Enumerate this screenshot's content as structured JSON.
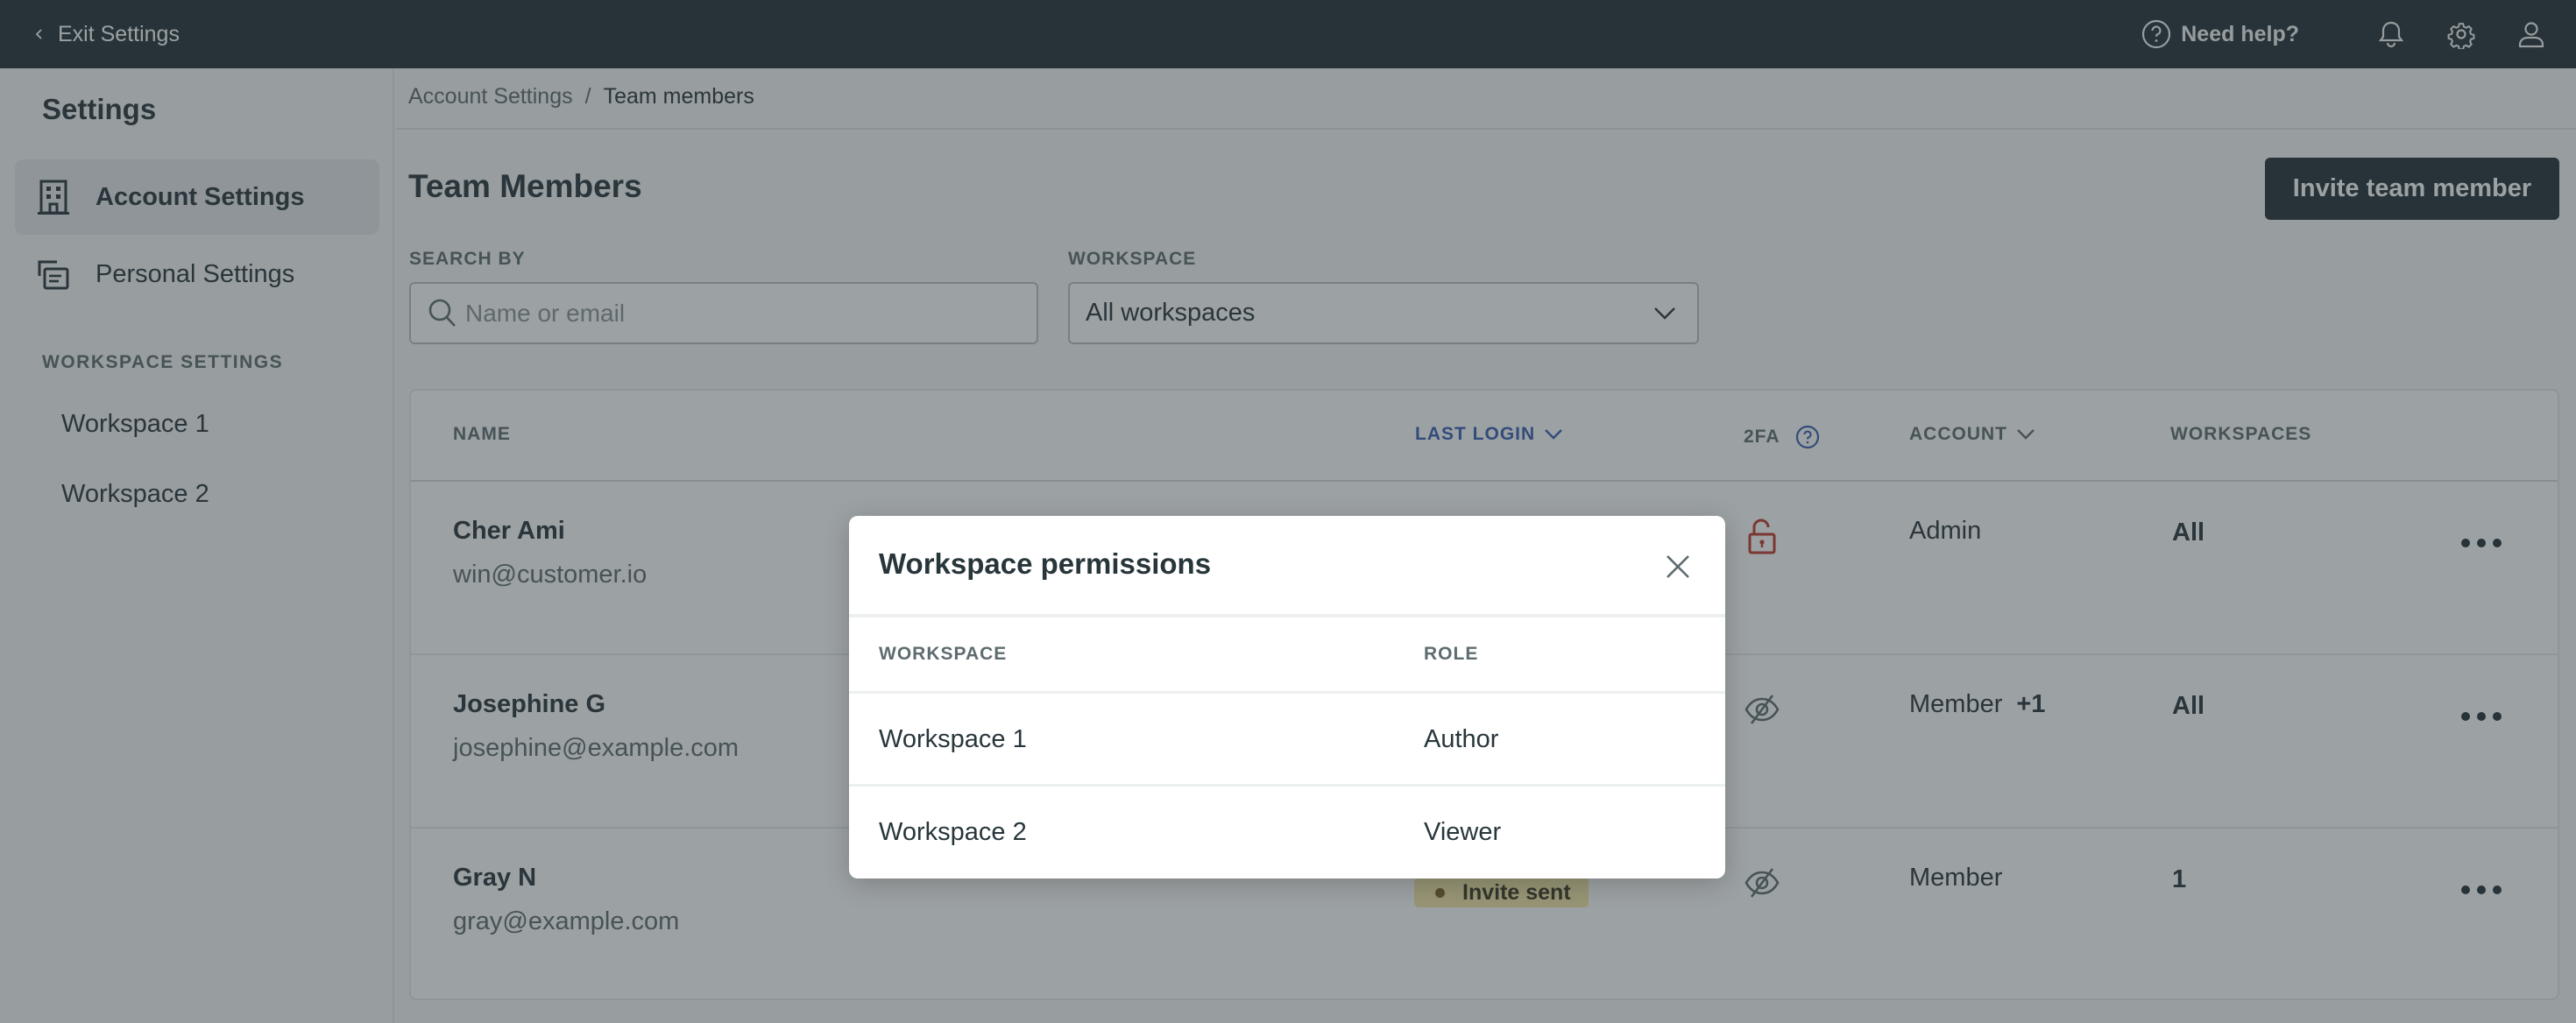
{
  "topbar": {
    "exit_label": "Exit Settings",
    "help_label": "Need help?",
    "icons": [
      "chevron-left-icon",
      "help-circle-icon",
      "bell-icon",
      "gear-icon",
      "user-icon"
    ]
  },
  "sidebar": {
    "title": "Settings",
    "items": [
      {
        "label": "Account Settings",
        "icon": "building-icon",
        "active": true
      },
      {
        "label": "Personal Settings",
        "icon": "cards-icon",
        "active": false
      }
    ],
    "section_label": "WORKSPACE SETTINGS",
    "workspaces": [
      {
        "label": "Workspace 1"
      },
      {
        "label": "Workspace 2"
      }
    ]
  },
  "breadcrumb": {
    "parent": "Account Settings",
    "separator": "/",
    "current": "Team members"
  },
  "page": {
    "title": "Team Members",
    "invite_button": "Invite team member"
  },
  "filters": {
    "search_label": "SEARCH BY",
    "search_placeholder": "Name or email",
    "search_value": "",
    "workspace_label": "WORKSPACE",
    "workspace_selected": "All workspaces"
  },
  "table": {
    "columns": {
      "name": "NAME",
      "last_login": "LAST LOGIN",
      "twofa": "2FA",
      "account": "ACCOUNT",
      "workspaces": "WORKSPACES"
    },
    "sorted_column": "last_login",
    "rows": [
      {
        "name": "Cher Ami",
        "email": "win@customer.io",
        "last_login": "",
        "twofa": "unlocked",
        "account": "Admin",
        "account_extra": "",
        "workspaces": "All"
      },
      {
        "name": "Josephine G",
        "email": "josephine@example.com",
        "last_login": "",
        "twofa": "hidden",
        "account": "Member",
        "account_extra": "+1",
        "workspaces": "All"
      },
      {
        "name": "Gray N",
        "email": "gray@example.com",
        "last_login": "Invite sent",
        "twofa": "hidden",
        "account": "Member",
        "account_extra": "",
        "workspaces": "1"
      }
    ]
  },
  "modal": {
    "title": "Workspace permissions",
    "columns": {
      "workspace": "WORKSPACE",
      "role": "ROLE"
    },
    "rows": [
      {
        "workspace": "Workspace 1",
        "role": "Author"
      },
      {
        "workspace": "Workspace 2",
        "role": "Viewer"
      }
    ]
  },
  "colors": {
    "topbar_bg": "#233036",
    "accent_blue": "#3a5fb5",
    "danger_red": "#c0392b",
    "invite_badge_bg": "#f5e9a8"
  }
}
